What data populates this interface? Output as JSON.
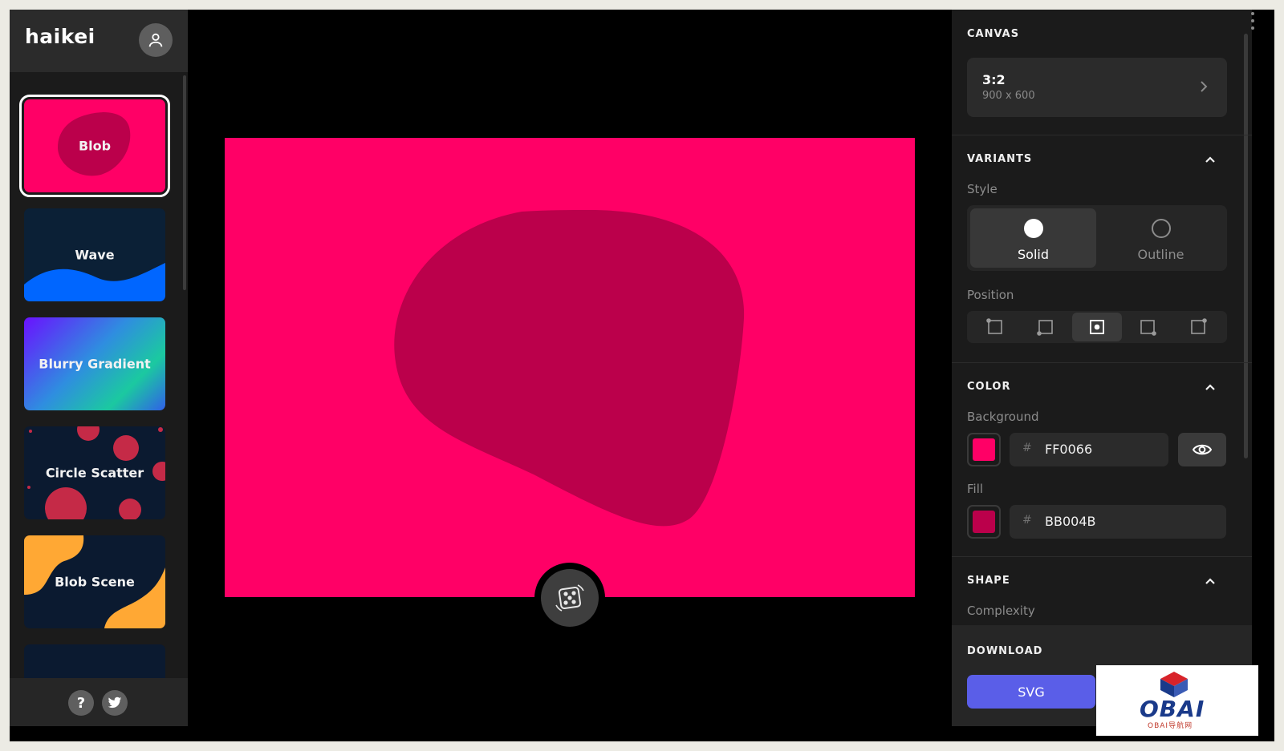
{
  "app": {
    "logo": "haikei"
  },
  "generators": [
    {
      "label": "Blob",
      "active": true
    },
    {
      "label": "Wave",
      "active": false
    },
    {
      "label": "Blurry Gradient",
      "active": false
    },
    {
      "label": "Circle Scatter",
      "active": false
    },
    {
      "label": "Blob Scene",
      "active": false
    }
  ],
  "footer": {
    "help_label": "?"
  },
  "panel": {
    "canvas": {
      "title": "CANVAS",
      "ratio": "3:2",
      "dims": "900 x 600"
    },
    "variants": {
      "title": "VARIANTS",
      "style_label": "Style",
      "styles": [
        {
          "label": "Solid",
          "selected": true
        },
        {
          "label": "Outline",
          "selected": false
        }
      ],
      "position_label": "Position",
      "position_selected": 3
    },
    "color": {
      "title": "COLOR",
      "background_label": "Background",
      "background_hex": "FF0066",
      "fill_label": "Fill",
      "fill_hex": "BB004B",
      "hash": "#"
    },
    "shape": {
      "title": "SHAPE",
      "complexity_label": "Complexity"
    },
    "download": {
      "title": "DOWNLOAD",
      "svg_label": "SVG"
    }
  },
  "colors": {
    "background": "#FF0066",
    "fill": "#BB004B",
    "accent": "#5a5ee8"
  },
  "watermark": {
    "text": "OBAI",
    "sub": "OBAI导航网"
  }
}
